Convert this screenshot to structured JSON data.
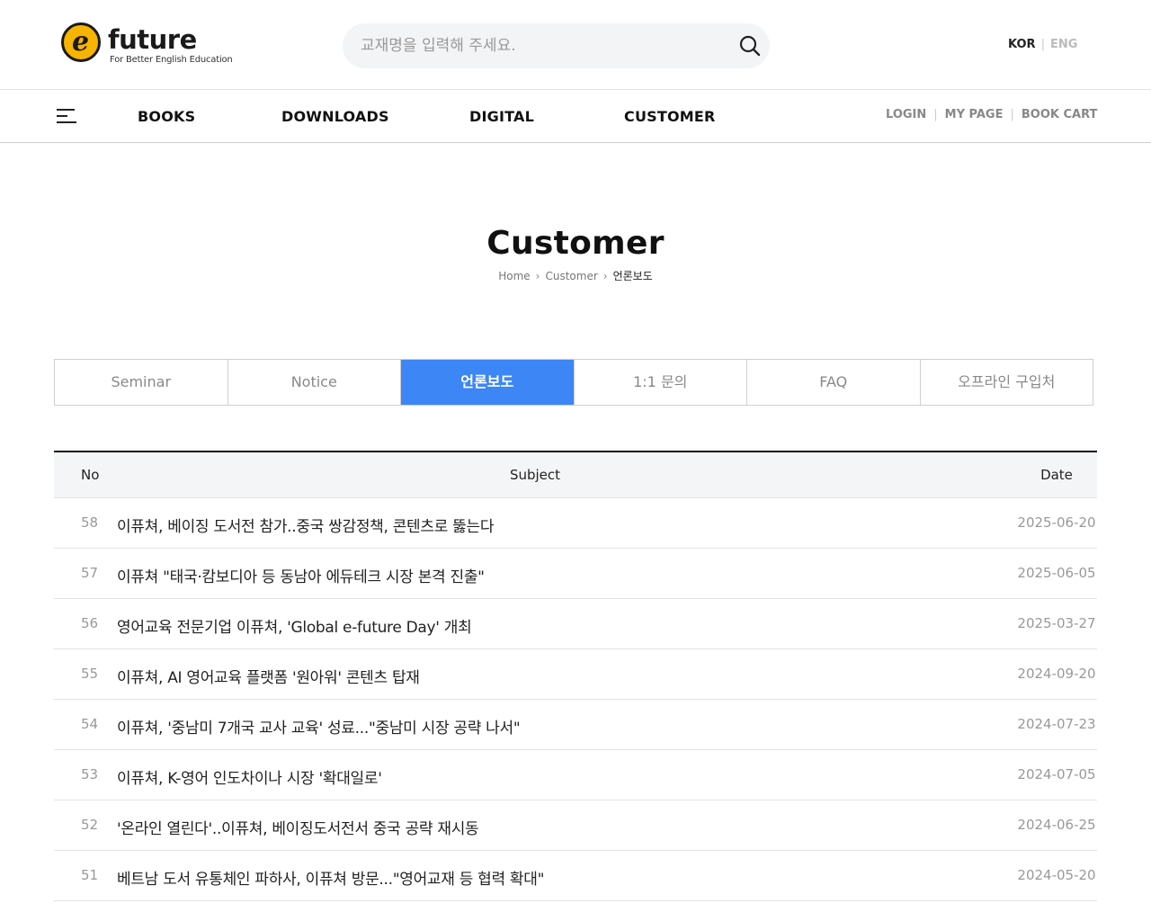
{
  "header": {
    "logo_letter": "e",
    "logo_word": "future",
    "logo_tagline": "For Better English Education",
    "search_placeholder": "교재명을 입력해 주세요.",
    "lang_kor": "KOR",
    "lang_eng": "ENG"
  },
  "nav": {
    "items": [
      "BOOKS",
      "DOWNLOADS",
      "DIGITAL",
      "CUSTOMER"
    ],
    "login": "LOGIN",
    "mypage": "MY PAGE",
    "cart": "BOOK CART"
  },
  "page": {
    "title": "Customer",
    "breadcrumb": [
      "Home",
      "Customer",
      "언론보도"
    ]
  },
  "tabs": [
    {
      "label": "Seminar",
      "active": false
    },
    {
      "label": "Notice",
      "active": false
    },
    {
      "label": "언론보도",
      "active": true
    },
    {
      "label": "1:1 문의",
      "active": false
    },
    {
      "label": "FAQ",
      "active": false
    },
    {
      "label": "오프라인 구입처",
      "active": false
    }
  ],
  "table": {
    "headers": {
      "no": "No",
      "subject": "Subject",
      "date": "Date"
    },
    "rows": [
      {
        "no": "58",
        "subject": "이퓨쳐, 베이징 도서전 참가..중국 쌍감정책, 콘텐츠로 뚫는다",
        "date": "2025-06-20"
      },
      {
        "no": "57",
        "subject": "이퓨쳐 \"태국·캄보디아 등 동남아 에듀테크 시장 본격 진출\"",
        "date": "2025-06-05"
      },
      {
        "no": "56",
        "subject": "영어교육 전문기업 이퓨쳐, 'Global e-future Day' 개최",
        "date": "2025-03-27"
      },
      {
        "no": "55",
        "subject": "이퓨쳐, AI 영어교육 플랫폼 '원아워' 콘텐츠 탑재",
        "date": "2024-09-20"
      },
      {
        "no": "54",
        "subject": "이퓨쳐, '중남미 7개국 교사 교육' 성료...\"중남미 시장 공략 나서\"",
        "date": "2024-07-23"
      },
      {
        "no": "53",
        "subject": "이퓨쳐, K-영어 인도차이나 시장 '확대일로'",
        "date": "2024-07-05"
      },
      {
        "no": "52",
        "subject": "'온라인 열린다'..이퓨쳐, 베이징도서전서 중국 공략 재시동",
        "date": "2024-06-25"
      },
      {
        "no": "51",
        "subject": "베트남 도서 유통체인 파하사, 이퓨쳐 방문...\"영어교재 등 협력 확대\"",
        "date": "2024-05-20"
      }
    ]
  }
}
